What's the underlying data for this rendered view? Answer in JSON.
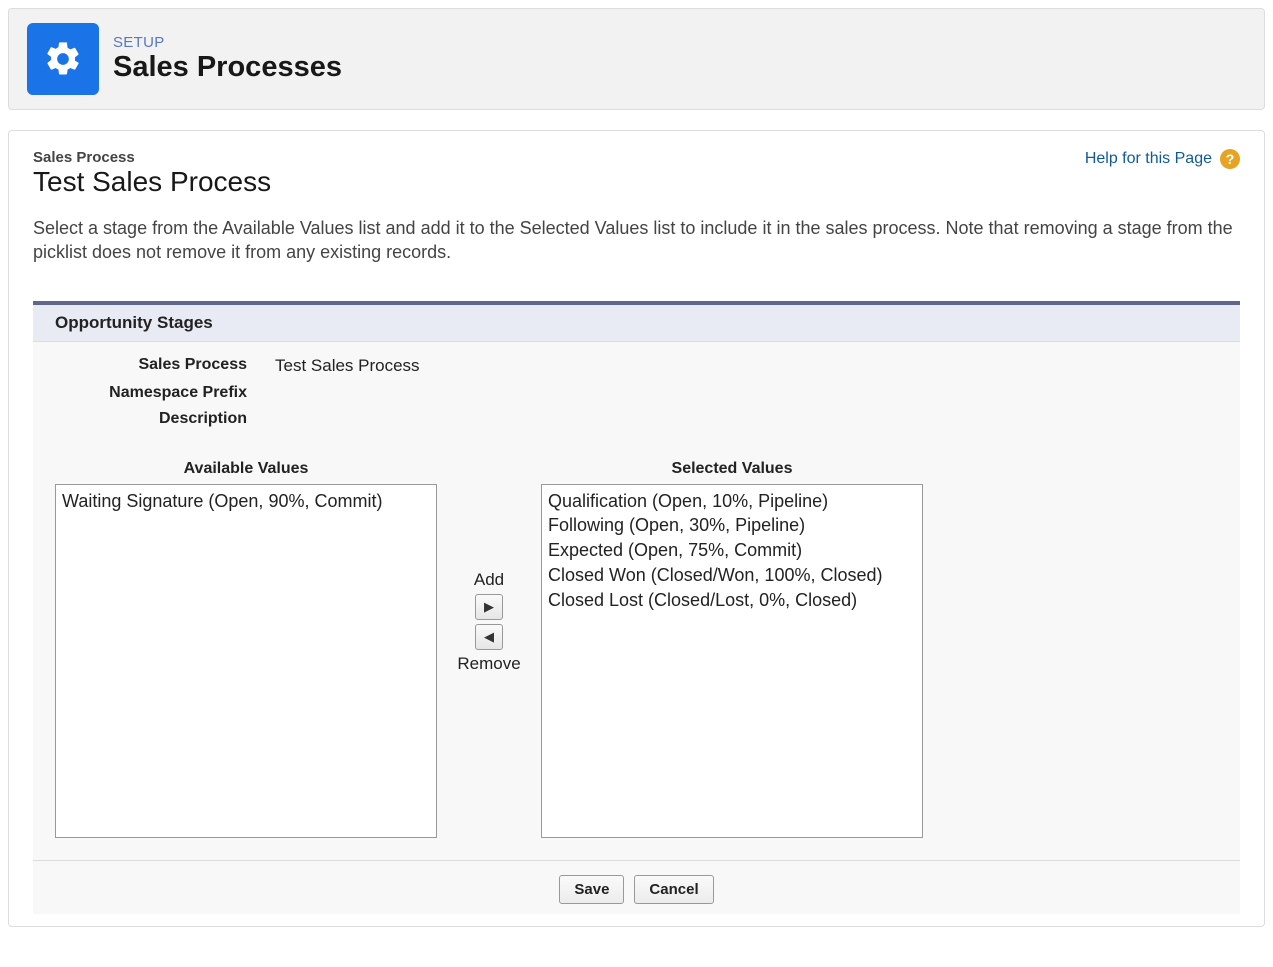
{
  "header": {
    "eyebrow": "SETUP",
    "title": "Sales Processes"
  },
  "content": {
    "record_type_label": "Sales Process",
    "record_name": "Test Sales Process",
    "help_link_label": "Help for this Page",
    "description": "Select a stage from the Available Values list and add it to the Selected Values list to include it in the sales process. Note that removing a stage from the picklist does not remove it from any existing records."
  },
  "section": {
    "title": "Opportunity Stages",
    "details": {
      "sales_process_label": "Sales Process",
      "sales_process_value": "Test Sales Process",
      "namespace_prefix_label": "Namespace Prefix",
      "namespace_prefix_value": "",
      "description_label": "Description",
      "description_value": ""
    },
    "lists": {
      "available_label": "Available Values",
      "selected_label": "Selected Values",
      "add_label": "Add",
      "remove_label": "Remove",
      "available": [
        "Waiting Signature (Open, 90%, Commit)"
      ],
      "selected": [
        "Qualification (Open, 10%, Pipeline)",
        "Following (Open, 30%, Pipeline)",
        "Expected (Open, 75%, Commit)",
        "Closed Won (Closed/Won, 100%, Closed)",
        "Closed Lost (Closed/Lost, 0%, Closed)"
      ]
    }
  },
  "footer": {
    "save_label": "Save",
    "cancel_label": "Cancel"
  }
}
